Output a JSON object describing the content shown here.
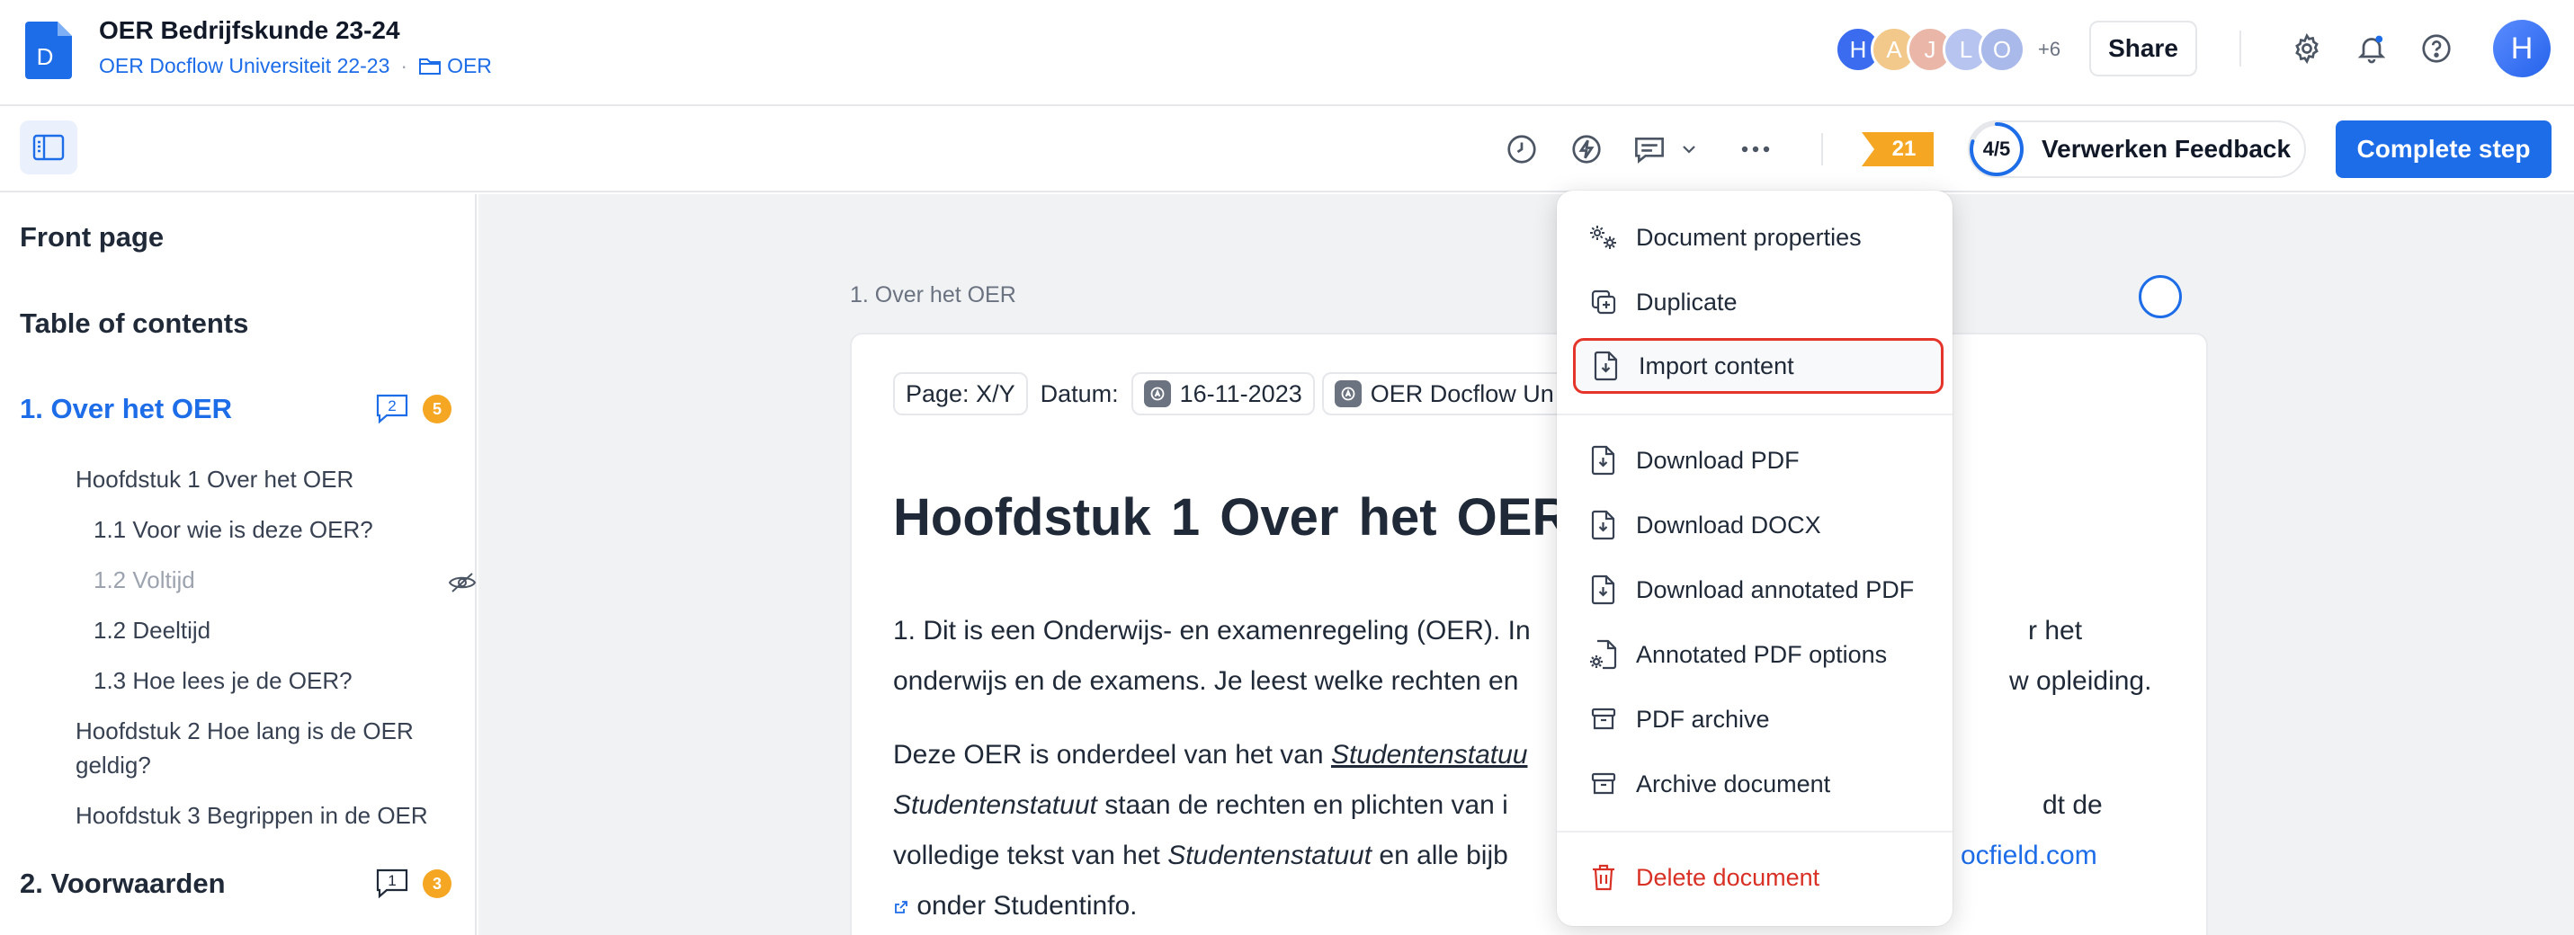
{
  "header": {
    "doc_title": "OER Bedrijfskunde 23-24",
    "breadcrumb_parent": "OER Docflow Universiteit 22-23",
    "breadcrumb_separator": "·",
    "breadcrumb_folder": "OER",
    "logo_letter": "D",
    "collaborators": [
      {
        "initial": "H",
        "color": "#3b6cf0"
      },
      {
        "initial": "A",
        "color": "#f2c98a"
      },
      {
        "initial": "J",
        "color": "#e9b6a8"
      },
      {
        "initial": "L",
        "color": "#b7c4f0"
      },
      {
        "initial": "O",
        "color": "#a9b9ea"
      }
    ],
    "more_collaborators": "+6",
    "share_label": "Share",
    "user_initial": "H"
  },
  "toolbar": {
    "badge_count": "21",
    "step_progress": "4/5",
    "step_fraction": 0.8,
    "step_label": "Verwerken Feedback",
    "complete_label": "Complete step"
  },
  "sidebar": {
    "front_page": "Front page",
    "toc": "Table of contents",
    "sections": [
      {
        "label": "1. Over het OER",
        "comments": "2",
        "count": "5"
      },
      {
        "label": "2. Voorwaarden",
        "comments": "1",
        "count": "3"
      }
    ],
    "items": [
      "Hoofdstuk 1 Over het OER",
      "1.1 Voor wie is deze OER?",
      "1.2 Voltijd",
      "1.2 Deeltijd",
      "1.3 Hoe lees je de OER?",
      "Hoofdstuk 2 Hoe lang is de OER",
      "geldig?",
      "Hoofdstuk 3 Begrippen in de OER"
    ]
  },
  "document": {
    "page_label": "1. Over het OER",
    "chip_page": "Page: X/Y",
    "chip_datum_label": "Datum:",
    "chip_date": "16-11-2023",
    "chip_org": "OER Docflow Un",
    "heading": "Hoofdstuk 1  Over het OER",
    "p1_a": "1.  Dit is een Onderwijs- en examenregeling (OER). In",
    "p1_b": "r het",
    "p1_c": "onderwijs en de examens. Je leest welke rechten en",
    "p1_d": "w opleiding.",
    "p2_a": "Deze OER is onderdeel van het van ",
    "p2_b": "Studentenstatuu",
    "p2_c": "Studentenstatuut",
    "p2_d": " staan de rechten en plichten van i",
    "p2_e": "dt de",
    "p2_f": "volledige tekst van het ",
    "p2_g": "Studentenstatuut",
    "p2_h": " en alle bijb",
    "p2_link": "ocfield.com",
    "p2_i": " onder Studentinfo."
  },
  "menu": {
    "items": [
      {
        "label": "Document properties",
        "icon": "gears-icon"
      },
      {
        "label": "Duplicate",
        "icon": "duplicate-icon"
      },
      {
        "label": "Import content",
        "icon": "import-file-icon"
      },
      {
        "label": "Download PDF",
        "icon": "download-file-icon"
      },
      {
        "label": "Download DOCX",
        "icon": "download-file-icon"
      },
      {
        "label": "Download annotated PDF",
        "icon": "download-file-icon"
      },
      {
        "label": "Annotated PDF options",
        "icon": "file-settings-icon"
      },
      {
        "label": "PDF archive",
        "icon": "archive-box-icon"
      },
      {
        "label": "Archive document",
        "icon": "archive-box-icon"
      },
      {
        "label": "Delete document",
        "icon": "trash-icon"
      }
    ]
  },
  "colors": {
    "accent": "#1d6ce8",
    "badge_orange": "#f5a623",
    "danger": "#d93025",
    "highlight_border": "#e5352b"
  }
}
